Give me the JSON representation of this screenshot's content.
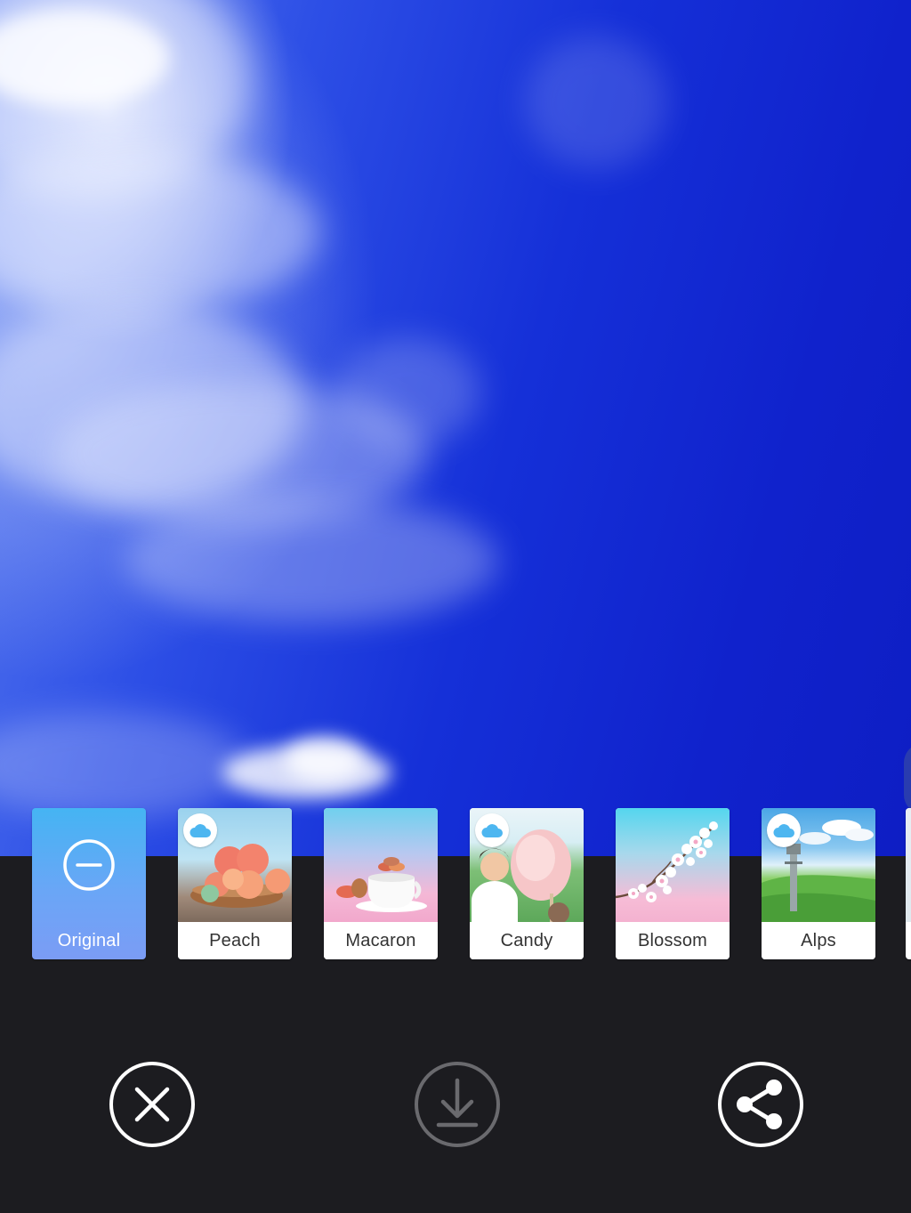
{
  "filters": {
    "items": [
      {
        "label": "Original",
        "selected": true,
        "cloud": false
      },
      {
        "label": "Peach",
        "selected": false,
        "cloud": true
      },
      {
        "label": "Macaron",
        "selected": false,
        "cloud": false
      },
      {
        "label": "Candy",
        "selected": false,
        "cloud": true
      },
      {
        "label": "Blossom",
        "selected": false,
        "cloud": false
      },
      {
        "label": "Alps",
        "selected": false,
        "cloud": true
      }
    ]
  },
  "actions": {
    "cancel_icon": "close-circle-icon",
    "download_icon": "download-icon",
    "share_icon": "share-icon",
    "download_enabled": false
  },
  "colors": {
    "background": "#1c1c20",
    "selected_gradient_top": "#45b4f3",
    "selected_gradient_bottom": "#7b9cf5",
    "cloud_badge": "#4db6f0",
    "icon_active": "#ffffff",
    "icon_disabled": "#6a6a6e"
  }
}
